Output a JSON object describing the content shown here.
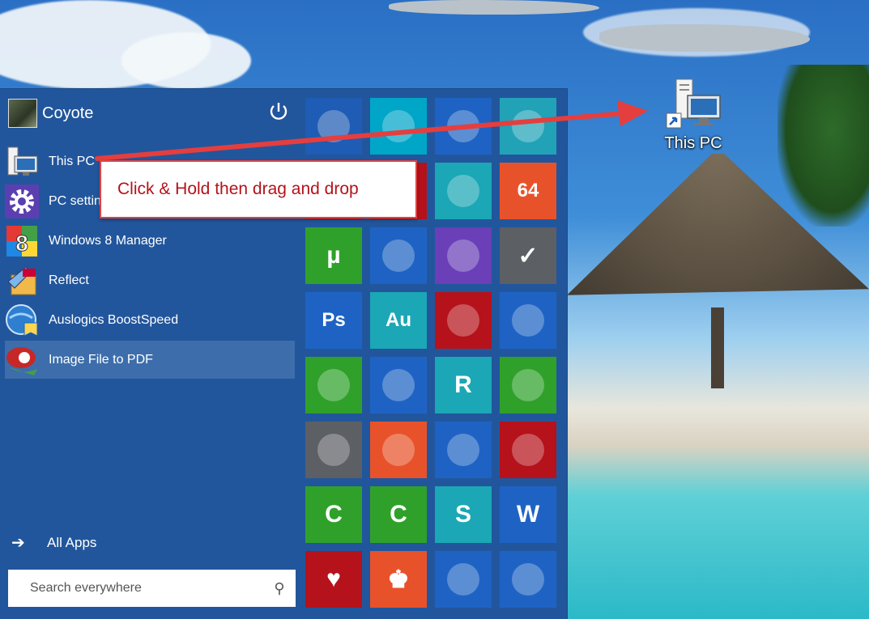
{
  "desktop": {
    "shortcut_label": "This PC"
  },
  "start_menu": {
    "user_name": "Coyote",
    "apps": [
      {
        "label": "This PC",
        "icon": "this-pc-icon"
      },
      {
        "label": "PC settings",
        "icon": "gear-icon"
      },
      {
        "label": "Windows 8 Manager",
        "icon": "windows8-manager-icon"
      },
      {
        "label": "Reflect",
        "icon": "reflect-icon"
      },
      {
        "label": "Auslogics BoostSpeed",
        "icon": "boostspeed-icon"
      },
      {
        "label": "Image File to PDF",
        "icon": "image-to-pdf-icon"
      }
    ],
    "all_apps_label": "All Apps",
    "search_placeholder": "Search everywhere",
    "tiles": [
      {
        "name": "this-pc-tile",
        "bg": "#1f5cb5",
        "glyph": ""
      },
      {
        "name": "store-tile",
        "bg": "#00a6c8",
        "glyph": ""
      },
      {
        "name": "control-panel-tile",
        "bg": "#1e63c4",
        "glyph": ""
      },
      {
        "name": "file-explorer-tile",
        "bg": "#22a2b7",
        "glyph": ""
      },
      {
        "name": "tile-hidden",
        "bg": "#b5121b",
        "glyph": ""
      },
      {
        "name": "tile-hidden-2",
        "bg": "#b5121b",
        "glyph": ""
      },
      {
        "name": "security-lock-tile",
        "bg": "#1ba7b5",
        "glyph": ""
      },
      {
        "name": "app-64-tile",
        "bg": "#e8522a",
        "glyph": "64"
      },
      {
        "name": "utorrent-tile",
        "bg": "#2fa12a",
        "glyph": "µ"
      },
      {
        "name": "media-player-tile",
        "bg": "#1e63c4",
        "glyph": ""
      },
      {
        "name": "disc-burner-tile",
        "bg": "#6a3fb8",
        "glyph": ""
      },
      {
        "name": "checkbox-app-tile",
        "bg": "#5c5f63",
        "glyph": "✓"
      },
      {
        "name": "photoshop-tile",
        "bg": "#1e63c4",
        "glyph": "Ps"
      },
      {
        "name": "audition-tile",
        "bg": "#1ba7b5",
        "glyph": "Au"
      },
      {
        "name": "refresh-app-tile",
        "bg": "#b5121b",
        "glyph": ""
      },
      {
        "name": "teamviewer-tile",
        "bg": "#1e63c4",
        "glyph": ""
      },
      {
        "name": "video-maker-tile",
        "bg": "#2fa12a",
        "glyph": ""
      },
      {
        "name": "cyberlink-tile",
        "bg": "#1e63c4",
        "glyph": ""
      },
      {
        "name": "reader-tile",
        "bg": "#1ba7b5",
        "glyph": "R"
      },
      {
        "name": "notepad-tile",
        "bg": "#2fa12a",
        "glyph": ""
      },
      {
        "name": "rocket-tile",
        "bg": "#5c5f63",
        "glyph": ""
      },
      {
        "name": "sheep-tile",
        "bg": "#e8522a",
        "glyph": ""
      },
      {
        "name": "malwarebytes-tile",
        "bg": "#1e63c4",
        "glyph": ""
      },
      {
        "name": "registry-tile",
        "bg": "#b5121b",
        "glyph": ""
      },
      {
        "name": "camtasia-tile",
        "bg": "#2fa12a",
        "glyph": "C"
      },
      {
        "name": "camtasia-2-tile",
        "bg": "#2fa12a",
        "glyph": "C"
      },
      {
        "name": "snagit-tile",
        "bg": "#1ba7b5",
        "glyph": "S"
      },
      {
        "name": "word-tile",
        "bg": "#1e63c4",
        "glyph": "W"
      },
      {
        "name": "solitaire-tile",
        "bg": "#b5121b",
        "glyph": "♥"
      },
      {
        "name": "chess-tile",
        "bg": "#e8522a",
        "glyph": "♚"
      },
      {
        "name": "virtual-box-tile",
        "bg": "#1e63c4",
        "glyph": ""
      },
      {
        "name": "people-tile",
        "bg": "#1e63c4",
        "glyph": ""
      }
    ]
  },
  "annotation": {
    "text": "Click & Hold then drag and drop",
    "color": "#e53e3e"
  }
}
